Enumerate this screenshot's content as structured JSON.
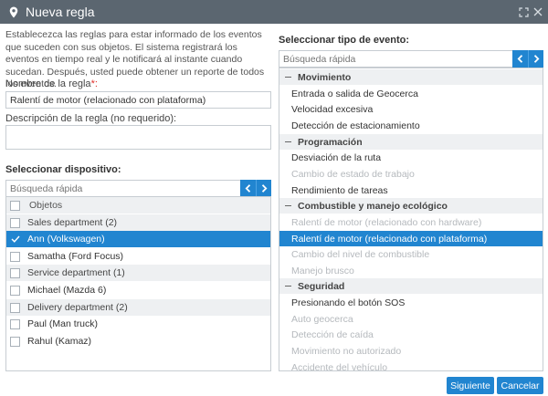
{
  "titlebar": {
    "title": "Nueva regla",
    "icons": {
      "app": "map-pin-icon",
      "expand": "expand-icon",
      "close": "close-icon"
    }
  },
  "intro": "Establecezca las reglas para estar informado de los eventos que suceden con sus objetos. El sistema registrará los eventos en tiempo real y le notificará al instante cuando sucedan. Después, usted puede obtener un reporte de todos los eventos.",
  "rule_name": {
    "label": "Nombre de la regla",
    "required_mark": "*:",
    "value": "Ralentí de motor (relacionado con plataforma)"
  },
  "rule_description": {
    "label": "Descripción de la regla (no requerido):",
    "value": ""
  },
  "devices": {
    "title": "Seleccionar dispositivo:",
    "search_placeholder": "Búsqueda rápida",
    "header": "Objetos",
    "rows": [
      {
        "label": "Sales department (2)",
        "type": "group",
        "checked": false
      },
      {
        "label": "Ann (Volkswagen)",
        "type": "item",
        "checked": true,
        "selected": true
      },
      {
        "label": "Samatha (Ford Focus)",
        "type": "item",
        "checked": false
      },
      {
        "label": "Service department (1)",
        "type": "group",
        "checked": false
      },
      {
        "label": "Michael (Mazda 6)",
        "type": "item",
        "checked": false
      },
      {
        "label": "Delivery department (2)",
        "type": "group",
        "checked": false
      },
      {
        "label": "Paul (Man truck)",
        "type": "item",
        "checked": false
      },
      {
        "label": "Rahul (Kamaz)",
        "type": "item",
        "checked": false
      }
    ]
  },
  "events": {
    "title": "Seleccionar tipo de evento:",
    "search_placeholder": "Búsqueda rápida",
    "rows": [
      {
        "label": "Movimiento",
        "type": "group"
      },
      {
        "label": "Entrada o salida de Geocerca",
        "type": "item",
        "enabled": true
      },
      {
        "label": "Velocidad excesiva",
        "type": "item",
        "enabled": true
      },
      {
        "label": "Detección de estacionamiento",
        "type": "item",
        "enabled": true
      },
      {
        "label": "Programación",
        "type": "group"
      },
      {
        "label": "Desviación de la ruta",
        "type": "item",
        "enabled": true
      },
      {
        "label": "Cambio de estado de trabajo",
        "type": "item",
        "enabled": false
      },
      {
        "label": "Rendimiento de tareas",
        "type": "item",
        "enabled": true
      },
      {
        "label": "Combustible y manejo ecológico",
        "type": "group"
      },
      {
        "label": "Ralentí de motor (relacionado con hardware)",
        "type": "item",
        "enabled": false
      },
      {
        "label": "Ralentí de motor (relacionado con plataforma)",
        "type": "item",
        "enabled": true,
        "selected": true
      },
      {
        "label": "Cambio del nivel de combustible",
        "type": "item",
        "enabled": false
      },
      {
        "label": "Manejo brusco",
        "type": "item",
        "enabled": false
      },
      {
        "label": "Seguridad",
        "type": "group"
      },
      {
        "label": "Presionando el botón SOS",
        "type": "item",
        "enabled": true
      },
      {
        "label": "Auto geocerca",
        "type": "item",
        "enabled": false
      },
      {
        "label": "Detección de caída",
        "type": "item",
        "enabled": false
      },
      {
        "label": "Movimiento no autorizado",
        "type": "item",
        "enabled": false
      },
      {
        "label": "Accidente del vehículo",
        "type": "item",
        "enabled": false
      }
    ]
  },
  "buttons": {
    "next": "Siguiente",
    "cancel": "Cancelar"
  },
  "colors": {
    "accent": "#2185d0",
    "titlebar": "#5b6670",
    "group_bg": "#eef0f2",
    "disabled": "#b5b9bd"
  }
}
